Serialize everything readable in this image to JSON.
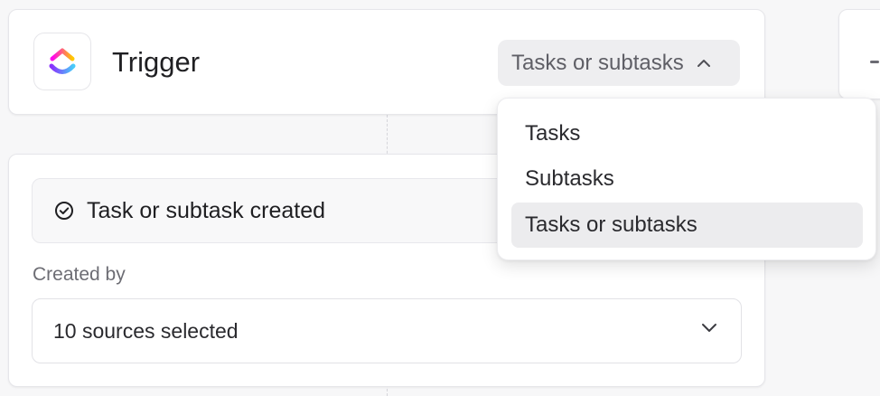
{
  "trigger": {
    "app_icon": "clickup-logo",
    "title": "Trigger",
    "type_select": {
      "selected": "Tasks or subtasks",
      "icon": "chevron-up-icon"
    }
  },
  "dropdown": {
    "items": [
      {
        "label": "Tasks",
        "selected": false
      },
      {
        "label": "Subtasks",
        "selected": false
      },
      {
        "label": "Tasks or subtasks",
        "selected": true
      }
    ]
  },
  "event": {
    "icon": "check-circle-icon",
    "label": "Task or subtask created"
  },
  "created_by": {
    "label": "Created by",
    "value": "10 sources selected",
    "icon": "chevron-down-icon"
  },
  "colors": {
    "logo_pink": "#ff02f0",
    "logo_purple": "#8930fd",
    "logo_orange": "#ffc800",
    "logo_blue": "#49ccf9"
  }
}
